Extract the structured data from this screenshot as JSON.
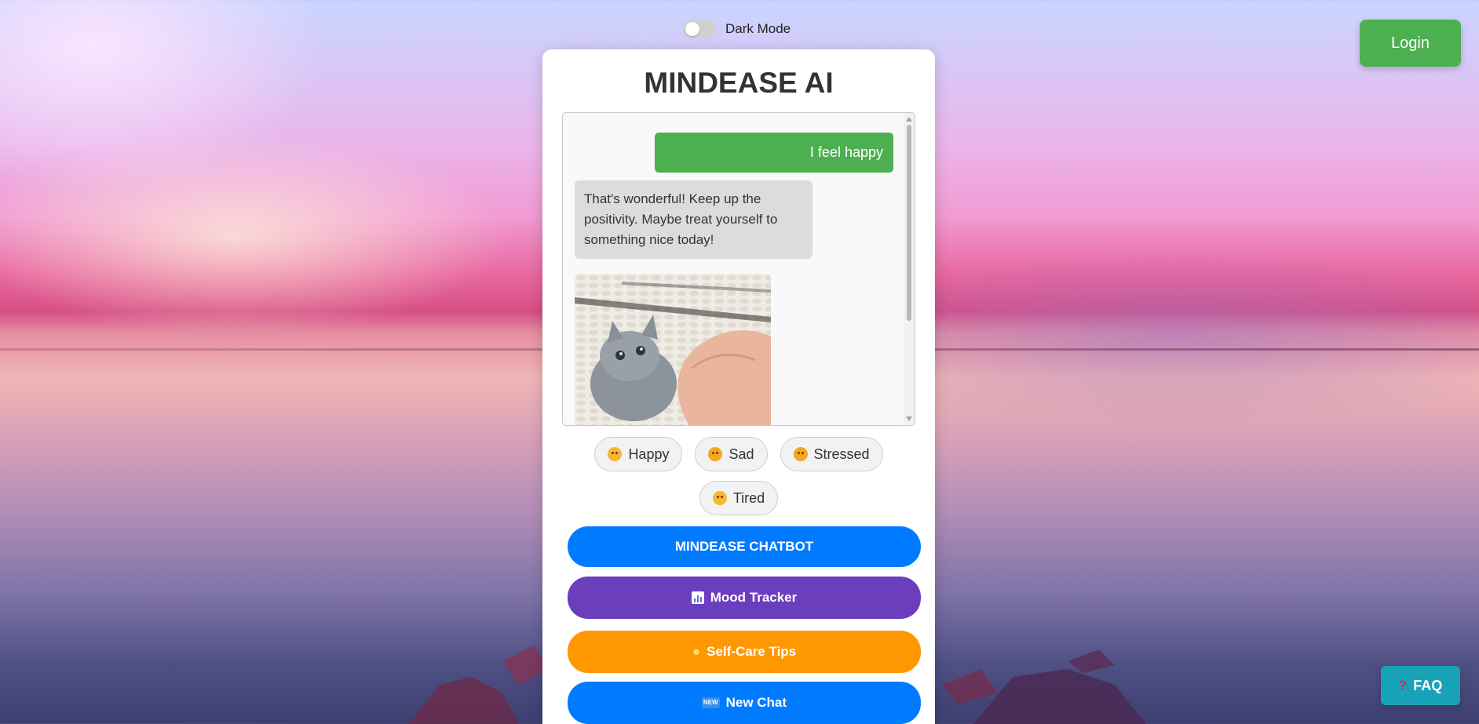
{
  "header": {
    "dark_mode_label": "Dark Mode",
    "login_label": "Login"
  },
  "app": {
    "title": "MINDEASE AI"
  },
  "chat": {
    "user_message": "I feel happy",
    "bot_message": "That's wonderful! Keep up the positivity. Maybe treat yourself to something nice today!",
    "image_alt": "kitten"
  },
  "moods": [
    {
      "label": "Happy",
      "icon": "smiling-face-icon"
    },
    {
      "label": "Sad",
      "icon": "sad-face-icon"
    },
    {
      "label": "Stressed",
      "icon": "stressed-face-icon"
    },
    {
      "label": "Tired",
      "icon": "sleepy-face-icon"
    }
  ],
  "actions": {
    "chatbot_label": "MINDEASE CHATBOT",
    "mood_tracker_label": "Mood Tracker",
    "self_care_label": "Self-Care Tips",
    "new_chat_label": "New Chat"
  },
  "faq": {
    "label": "FAQ"
  },
  "colors": {
    "login": "#4caf50",
    "user_bubble": "#4caf50",
    "chatbot_button": "#007bff",
    "mood_button": "#6a3ebd",
    "selfcare_button": "#ff9800",
    "newchat_button": "#007bff",
    "faq_button": "#17a2b8"
  }
}
